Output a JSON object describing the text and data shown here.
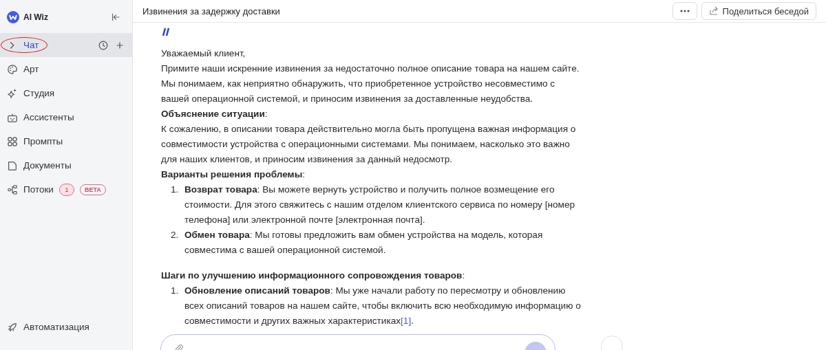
{
  "sidebar": {
    "brand": "AI Wiz",
    "items": [
      {
        "label": "Чат",
        "selected": true,
        "expandable": true
      },
      {
        "label": "Арт",
        "selected": false
      },
      {
        "label": "Студия",
        "selected": false
      },
      {
        "label": "Ассистенты",
        "selected": false
      },
      {
        "label": "Промпты",
        "selected": false
      },
      {
        "label": "Документы",
        "selected": false
      },
      {
        "label": "Потоки",
        "selected": false,
        "count": "1",
        "badge": "BETA"
      }
    ],
    "bottom_items": [
      {
        "label": "Автоматизация",
        "selected": false
      }
    ]
  },
  "header": {
    "title": "Извинения за задержку доставки",
    "share_button": "Поделиться беседой"
  },
  "message": [
    {
      "kind": "paragraph",
      "text": "Уважаемый клиент,"
    },
    {
      "kind": "paragraph",
      "text": "Примите наши искренние извинения за недостаточно полное описание товара на нашем сайте."
    },
    {
      "kind": "paragraph",
      "text": "Мы понимаем, как неприятно обнаружить, что приобретенное устройство несовместимо с вашей операционной системой, и приносим извинения за доставленные неудобства."
    },
    {
      "kind": "paragraph",
      "text": "**Объяснение ситуации**:"
    },
    {
      "kind": "paragraph",
      "text": "К сожалению, в описании товара действительно могла быть пропущена важная информация о совместимости устройства с операционными системами. Мы понимаем, насколько это важно для наших клиентов, и приносим извинения за данный недосмотр."
    },
    {
      "kind": "paragraph",
      "text": "**Варианты решения проблемы**:"
    },
    {
      "kind": "list",
      "items": [
        {
          "number": "1.",
          "text": "**Возврат товара**: Вы можете вернуть устройство и получить полное возмещение его стоимости. Для этого свяжитесь с нашим отделом клиентского сервиса по номеру [номер телефона] или электронной почте [электронная почта]."
        },
        {
          "number": "2.",
          "text": "**Обмен товара**: Мы готовы предложить вам обмен устройства на модель, которая совместима с вашей операционной системой."
        }
      ]
    },
    {
      "kind": "section",
      "text": "**Шаги по улучшению информационного сопровождения товаров**:"
    },
    {
      "kind": "list",
      "items": [
        {
          "number": "1.",
          "text": "**Обновление описаний товаров**: Мы уже начали работу по пересмотру и обновлению всех описаний товаров на нашем сайте, чтобы включить всю необходимую информацию о совместимости и других важных характеристиках",
          "citation": "[1]",
          "tail": "."
        }
      ]
    }
  ]
}
